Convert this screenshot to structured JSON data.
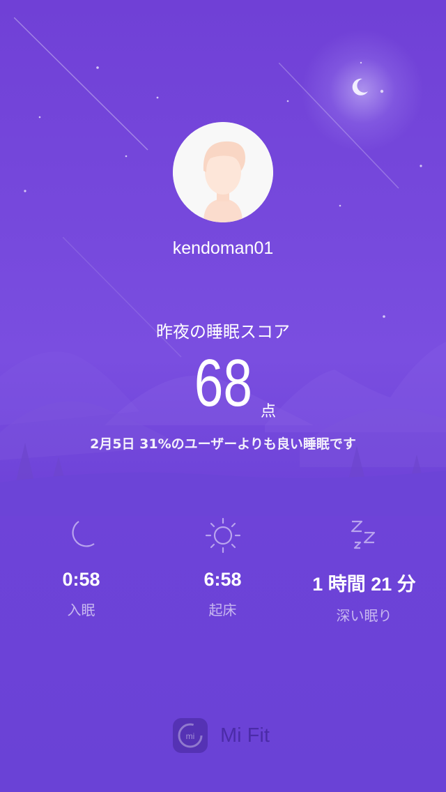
{
  "profile": {
    "username": "kendoman01"
  },
  "score": {
    "title": "昨夜の睡眠スコア",
    "value": "68",
    "unit": "点",
    "summary": "2月5日 31%のユーザーよりも良い睡眠です"
  },
  "stats": [
    {
      "icon": "moon-icon",
      "value": "0:58",
      "label": "入眠"
    },
    {
      "icon": "sun-icon",
      "value": "6:58",
      "label": "起床"
    },
    {
      "icon": "zzz-icon",
      "value": "1 時間 21 分",
      "label": "深い眠り"
    }
  ],
  "brand": {
    "name": "Mi Fit",
    "logo_text": "mi"
  },
  "colors": {
    "background": "#7040d6",
    "text": "#ffffff",
    "muted_text": "#b9a4ee"
  }
}
